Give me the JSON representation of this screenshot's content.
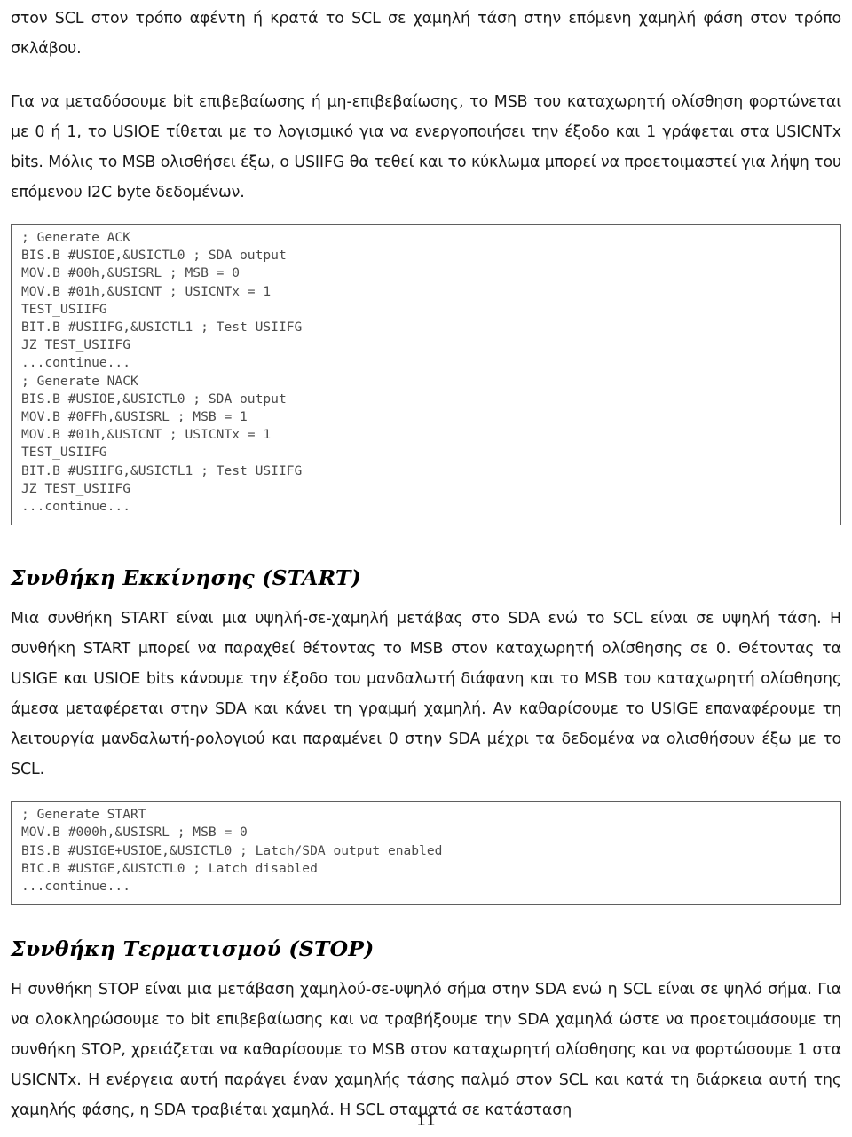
{
  "document": {
    "page_number": "11",
    "language": "el"
  },
  "blocks": {
    "intro_paragraph_continued": "στον SCL στον τρόπο αφέντη ή κρατά το SCL σε χαμηλή τάση στην επόμενη χαμηλή φάση στον τρόπο σκλάβου.",
    "ack_paragraph": "Για να μεταδόσουμε bit επιβεβαίωσης ή μη-επιβεβαίωσης, το MSB του καταχωρητή ολίσθηση φορτώνεται με 0 ή 1, το USIOE τίθεται με το λογισμικό για να ενεργοποιήσει την έξοδο και 1 γράφεται στα USICNTx bits. Μόλις το MSB ολισθήσει έξω, ο USIIFG θα τεθεί και το κύκλωμα μπορεί να προετοιμαστεί για λήψη του επόμενου I2C byte δεδομένων.",
    "ack_nack_code": "; Generate ACK\nBIS.B #USIOE,&USICTL0 ; SDA output\nMOV.B #00h,&USISRL ; MSB = 0\nMOV.B #01h,&USICNT ; USICNTx = 1\nTEST_USIIFG\nBIT.B #USIIFG,&USICTL1 ; Test USIIFG\nJZ TEST_USIIFG\n...continue...\n; Generate NACK\nBIS.B #USIOE,&USICTL0 ; SDA output\nMOV.B #0FFh,&USISRL ; MSB = 1\nMOV.B #01h,&USICNT ; USICNTx = 1\nTEST_USIIFG\nBIT.B #USIIFG,&USICTL1 ; Test USIIFG\nJZ TEST_USIIFG\n...continue...",
    "start_heading": "Συνθήκη Εκκίνησης (START)",
    "start_paragraph": "Μια συνθήκη START είναι μια υψηλή-σε-χαμηλή μετάβας στο SDA ενώ το SCL είναι σε υψηλή τάση. Η συνθήκη START μπορεί να παραχθεί θέτοντας το MSB στον καταχωρητή ολίσθησης σε 0. Θέτοντας τα USIGE και USIOE bits κάνουμε την έξοδο του μανδαλωτή διάφανη και το MSB του καταχωρητή ολίσθησης άμεσα μεταφέρεται στην SDA και κάνει τη γραμμή χαμηλή. Αν καθαρίσουμε το USIGE επαναφέρουμε τη λειτουργία μανδαλωτή-ρολογιού και παραμένει 0 στην SDA μέχρι τα δεδομένα να ολισθήσουν έξω με το SCL.",
    "start_code": "; Generate START\nMOV.B #000h,&USISRL ; MSB = 0\nBIS.B #USIGE+USIOE,&USICTL0 ; Latch/SDA output enabled\nBIC.B #USIGE,&USICTL0 ; Latch disabled\n...continue...",
    "stop_heading": "Συνθήκη Τερματισμού (STOP)",
    "stop_paragraph": "Η συνθήκη STOP είναι μια μετάβαση χαμηλού-σε-υψηλό σήμα στην SDA ενώ η SCL είναι σε ψηλό σήμα. Για να ολοκληρώσουμε το bit επιβεβαίωσης και να τραβήξουμε την SDA χαμηλά ώστε να προετοιμάσουμε τη συνθήκη STOP, χρειάζεται να καθαρίσουμε το MSB στον καταχωρητή ολίσθησης και να φορτώσουμε 1 στα USICNTx. Η ενέργεια αυτή παράγει έναν χαμηλής τάσης παλμό στον SCL και κατά τη διάρκεια αυτή της χαμηλής φάσης, η SDA τραβιέται χαμηλά. Η SCL σταματά σε κατάσταση"
  },
  "colors": {
    "text": "#1a1a1a",
    "code_text": "#4a4a4a",
    "code_border": "#5f5f5f",
    "background": "#ffffff"
  }
}
